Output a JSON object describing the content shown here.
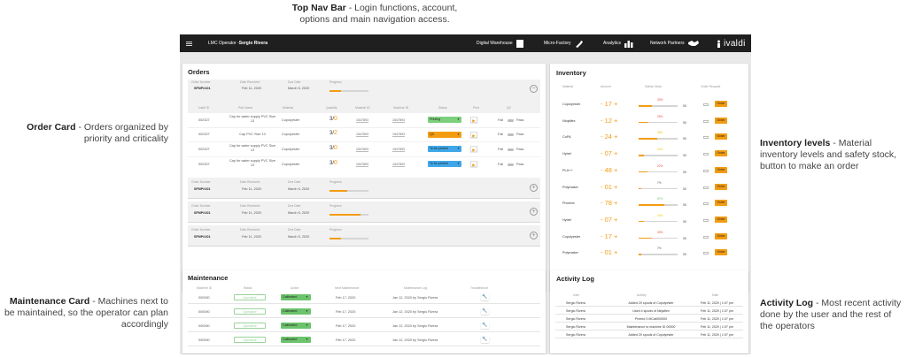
{
  "annotations": {
    "top_nav": {
      "title": "Top Nav Bar",
      "text": " - Login functions, account, options and main navigation access."
    },
    "order_card": {
      "title": "Order Card",
      "text": " - Orders organized by priority and criticality"
    },
    "maintenance_card": {
      "title": "Maintenance Card",
      "text": " - Machines next to be maintained, so the operator can plan accordingly"
    },
    "inventory_levels": {
      "title": "Inventory levels",
      "text": " - Material inventory levels and safety stock, button to make an order"
    },
    "activity_log": {
      "title": "Activity Log",
      "text": " - Most recent activity done by the user and the rest of the operators"
    }
  },
  "nav": {
    "menu_icon": "hamburger-icon",
    "role": "LMC Operator - ",
    "user": "Sergio Rivera",
    "links": [
      "Digital Warehouse",
      "Micro-Factory",
      "Analytics",
      "Network Partners"
    ],
    "brand": "ivaldi"
  },
  "orders": {
    "title": "Orders",
    "header": {
      "order_number": "Order Number",
      "date_received": "Date Received",
      "due_date": "Due Date",
      "progress": "Progress"
    },
    "item_header": {
      "id": "Ivaldi ID",
      "part": "Part Name",
      "material": "Material",
      "quantity": "Quantity",
      "material_id": "Material ID",
      "machine_id": "Machine ID",
      "status": "Status",
      "print": "Print",
      "qc": "QC"
    },
    "blocks": [
      {
        "number": "SFNP#101",
        "received": "Feb 11, 2020",
        "due": "March 5, 2020",
        "progress": 0.3,
        "expanded": true
      },
      {
        "number": "SFNP#101",
        "received": "Feb 11, 2020",
        "due": "March 5, 2020",
        "progress": 0.45,
        "expanded": false
      },
      {
        "number": "SFNP#101",
        "received": "Feb 11, 2020",
        "due": "March 5, 2020",
        "progress": 0.8,
        "expanded": false
      },
      {
        "number": "SFNP#101",
        "received": "Feb 11, 2020",
        "due": "March 5, 2020",
        "progress": 0.3,
        "expanded": false
      }
    ],
    "items": [
      {
        "id": "002327",
        "part": "Cap for water supply PVC Size 13",
        "material": "Copolyester",
        "qty_num": "3/",
        "qty_den": "0",
        "material_id": "1547893",
        "machine_id": "1547893",
        "status": "Printing",
        "status_color": "#7ccf7c",
        "fail": "Fail",
        "pass": "Pass"
      },
      {
        "id": "002327",
        "part": "Cap PVC Size 13",
        "material": "Copolyester",
        "qty_num": "3/",
        "qty_den": "2",
        "material_id": "1547893",
        "machine_id": "1547893",
        "status": "QC",
        "status_color": "#f39c12",
        "fail": "Fail",
        "pass": "Pass"
      },
      {
        "id": "002327",
        "part": "Cap for water supply PVC Size 13",
        "material": "Copolyester",
        "qty_num": "3/",
        "qty_den": "0",
        "material_id": "1547893",
        "machine_id": "1547893",
        "status": "To be printed",
        "status_color": "#3fa7e8",
        "fail": "Fail",
        "pass": "Pass"
      },
      {
        "id": "002327",
        "part": "Cap for water supply PVC Size 13",
        "material": "Copolyester",
        "qty_num": "3/",
        "qty_den": "0",
        "material_id": "1547893",
        "machine_id": "1547893",
        "status": "To be printed",
        "status_color": "#3fa7e8",
        "fail": "Fail",
        "pass": "Pass"
      }
    ]
  },
  "inventory": {
    "title": "Inventory",
    "header": {
      "material": "Material",
      "amount": "Amount",
      "safety": "Safety Stock",
      "order": "Order Request"
    },
    "order_label": "Order",
    "rows": [
      {
        "material": "Copolyester",
        "amount": "- 17 +",
        "pct": "33%",
        "level": 0.33,
        "max": "50",
        "pct_color": "#e74c3c"
      },
      {
        "material": "Ninjaflex",
        "amount": "- 12 +",
        "pct": "25%",
        "level": 0.25,
        "max": "50",
        "pct_color": "#e74c3c"
      },
      {
        "material": "CoPA",
        "amount": "- 24 +",
        "pct": "48%",
        "level": 0.48,
        "max": "50",
        "pct_color": "#f1c40f"
      },
      {
        "material": "Hytrel",
        "amount": "- 07 +",
        "pct": "14%",
        "level": 0.14,
        "max": "50",
        "pct_color": "#f1c40f"
      },
      {
        "material": "PLA++",
        "amount": "- 48 +",
        "pct": "22%",
        "level": 0.22,
        "max": "50",
        "pct_color": "#e74c3c"
      },
      {
        "material": "Polymaker",
        "amount": "- 01 +",
        "pct": "7%",
        "level": 0.07,
        "max": "50",
        "pct_color": "#555555"
      },
      {
        "material": "Phoenix",
        "amount": "- 78 +",
        "pct": "67%",
        "level": 0.67,
        "max": "50",
        "pct_color": "#6cc36c"
      },
      {
        "material": "Hytrel",
        "amount": "- 07 +",
        "pct": "14%",
        "level": 0.14,
        "max": "50",
        "pct_color": "#f1c40f"
      },
      {
        "material": "Copolyester",
        "amount": "- 17 +",
        "pct": "33%",
        "level": 0.33,
        "max": "50",
        "pct_color": "#e74c3c"
      },
      {
        "material": "Polymaker",
        "amount": "- 01 +",
        "pct": "7%",
        "level": 0.07,
        "max": "50",
        "pct_color": "#555555"
      }
    ]
  },
  "maintenance": {
    "title": "Maintenance",
    "header": {
      "machine": "Machine ID",
      "status": "Status",
      "action": "Action",
      "next": "Next Maintenance",
      "log": "Maintenance Log",
      "trouble": "Troubleshoot"
    },
    "rows": [
      {
        "machine": "000000",
        "status": "Operative",
        "action": "Calibrated",
        "next": "Feb 17, 2020",
        "log": "Jan 12, 2020 by Sergio Rivera"
      },
      {
        "machine": "000000",
        "status": "Operative",
        "action": "Calibrated",
        "next": "Feb 17, 2020",
        "log": "Jan 12, 2020 by Sergio Rivera"
      },
      {
        "machine": "000000",
        "status": "Operative",
        "action": "Calibrated",
        "next": "Feb 17, 2020",
        "log": "Jan 12, 2020 by Sergio Rivera"
      },
      {
        "machine": "000000",
        "status": "Operative",
        "action": "Calibrated",
        "next": "Feb 17, 2020",
        "log": "Jan 12, 2020 by Sergio Rivera"
      }
    ]
  },
  "activity": {
    "title": "Activity Log",
    "header": {
      "user": "User",
      "activity": "Activity",
      "date": "Date"
    },
    "rows": [
      {
        "user": "Sergio Rivera",
        "activity": "Added 20 spools of Copolyester",
        "date": "Feb 11, 2020 | 1:07 pm"
      },
      {
        "user": "Sergio Rivera",
        "activity": "Used 4 spools of Ninjaflex",
        "date": "Feb 11, 2020 | 1:07 pm"
      },
      {
        "user": "Sergio Rivera",
        "activity": "Printed 3 MCat000000",
        "date": "Feb 11, 2020 | 1:07 pm"
      },
      {
        "user": "Sergio Rivera",
        "activity": "Maintenance to machine ID 00000",
        "date": "Feb 11, 2020 | 1:07 pm"
      },
      {
        "user": "Sergio Rivera",
        "activity": "Added 20 spools of Copolyester",
        "date": "Feb 11, 2020 | 1:07 pm"
      }
    ]
  }
}
